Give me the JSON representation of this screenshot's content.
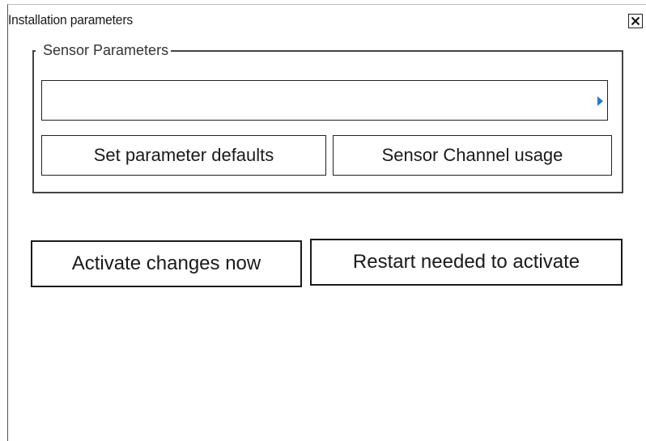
{
  "dialog": {
    "title": "Installation parameters",
    "close_icon": "close-icon"
  },
  "sensor_group": {
    "legend": "Sensor Parameters",
    "selector_value": "",
    "selector_arrow_icon": "triangle-right-icon",
    "arrow_color": "#1a7fd4",
    "buttons": {
      "set_defaults": "Set parameter defaults",
      "channel_usage": "Sensor Channel usage"
    }
  },
  "actions": {
    "activate_now": "Activate changes now",
    "restart_needed": "Restart needed to activate"
  }
}
